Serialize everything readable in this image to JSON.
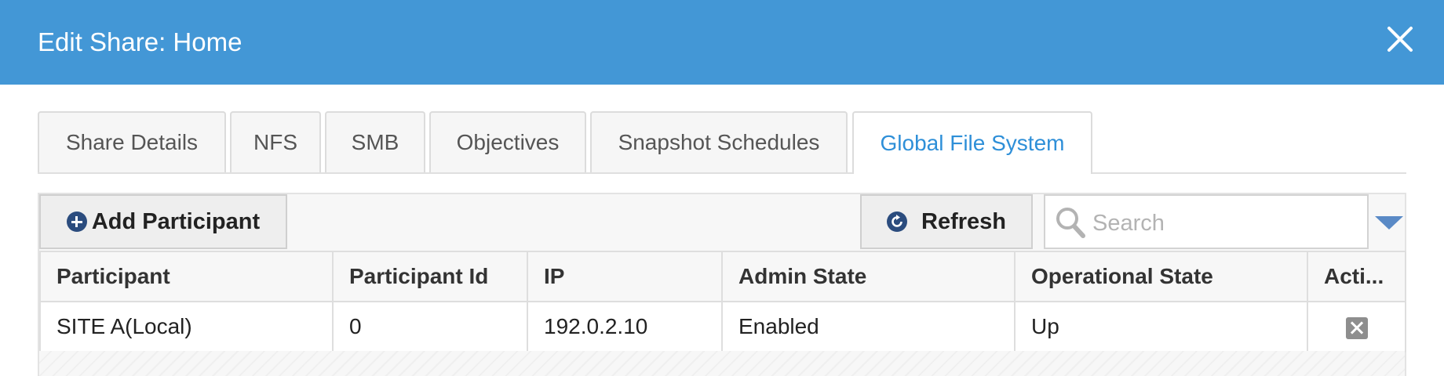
{
  "header": {
    "title": "Edit Share: Home",
    "background_color": "#4397d6",
    "close_icon": "close-icon"
  },
  "tabs": [
    {
      "label": "Share Details",
      "active": false
    },
    {
      "label": "NFS",
      "active": false
    },
    {
      "label": "SMB",
      "active": false
    },
    {
      "label": "Objectives",
      "active": false
    },
    {
      "label": "Snapshot Schedules",
      "active": false
    },
    {
      "label": "Global File System",
      "active": true
    }
  ],
  "active_tab_color": "#2e8fd8",
  "toolbar": {
    "add_participant_label": "Add Participant",
    "add_participant_icon": "plus-circle-icon",
    "refresh_label": "Refresh",
    "refresh_icon": "refresh-icon",
    "search_placeholder": "Search",
    "search_value": "",
    "search_icon": "magnifier-icon",
    "dropdown_icon": "triangle-down-icon"
  },
  "table": {
    "columns": [
      "Participant",
      "Participant Id",
      "IP",
      "Admin State",
      "Operational State",
      "Acti..."
    ],
    "rows": [
      {
        "participant": "SITE A(Local)",
        "participant_id": "0",
        "ip": "192.0.2.10",
        "admin_state": "Enabled",
        "operational_state": "Up",
        "action_icon": "delete-icon"
      }
    ]
  }
}
